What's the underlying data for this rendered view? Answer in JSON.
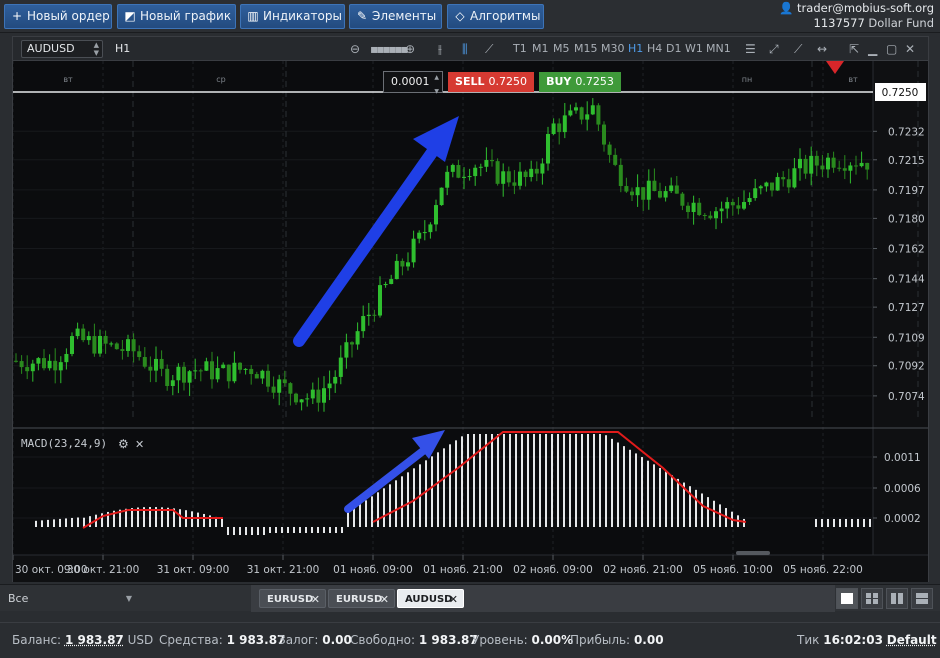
{
  "toolbar": {
    "new_order": "Новый ордер",
    "new_chart": "Новый график",
    "indicators": "Индикаторы",
    "elements": "Элементы",
    "algorithms": "Алгоритмы"
  },
  "account": {
    "email": "trader@mobius-soft.org",
    "id": "1137577",
    "fund": "Dollar Fund"
  },
  "chart": {
    "symbol": "AUDUSD",
    "timeframe": "H1",
    "timeframes": [
      "T1",
      "M1",
      "M5",
      "M15",
      "M30",
      "H1",
      "H4",
      "D1",
      "W1",
      "MN1"
    ],
    "active_timeframe": "H1",
    "step_value": "0.0001",
    "sell_label": "SELL",
    "sell_price": "0.7250",
    "buy_label": "BUY",
    "buy_price": "0.7253",
    "current_price_label": "0.7250",
    "day_labels": [
      "вт",
      "ср",
      "пн",
      "вт"
    ],
    "indicator_label": "MACD(23,24,9)",
    "colors": {
      "bull": "#2fbf2f",
      "bear": "#2a8a1e",
      "macd_signal": "#e11b1b",
      "arrow": "#1f3fe6",
      "sell": "#d63a32",
      "buy": "#3f9a3a"
    }
  },
  "chart_data": {
    "type": "candlestick",
    "x_tick_labels": [
      "30 окт. 09:00",
      "30 окт. 21:00",
      "31 окт. 09:00",
      "31 окт. 21:00",
      "01 нояб. 09:00",
      "01 нояб. 21:00",
      "02 нояб. 09:00",
      "02 нояб. 21:00",
      "05 нояб. 10:00",
      "05 нояб. 22:00"
    ],
    "y_tick_labels": [
      "0.7232",
      "0.7215",
      "0.7197",
      "0.7180",
      "0.7162",
      "0.7144",
      "0.7127",
      "0.7109",
      "0.7092",
      "0.7074"
    ],
    "ylim": [
      0.7059,
      0.7271
    ],
    "current_price": 0.725,
    "macd": {
      "name": "MACD(23,24,9)",
      "y_tick_labels": [
        "0.0011",
        "0.0006",
        "0.0002"
      ],
      "histogram_shape": "rises from near zero at 31 окт. 21:00 to a plateau around 01 нояб. 21:00 – 02 нояб. 09:00, then declines back to zero by 05 нояб. 10:00",
      "signal_color": "red"
    }
  },
  "tabs": {
    "filter_label": "Все",
    "items": [
      {
        "label": "EURUSD",
        "active": false
      },
      {
        "label": "EURUSD",
        "active": false
      },
      {
        "label": "AUDUSD",
        "active": true
      }
    ]
  },
  "status": {
    "balance_label": "Баланс:",
    "balance_value": "1 983.87",
    "balance_currency": "USD",
    "equity_label": "Средства:",
    "equity_value": "1 983.87",
    "margin_label": "Залог:",
    "margin_value": "0.00",
    "free_label": "Свободно:",
    "free_value": "1 983.87",
    "level_label": "Уровень:",
    "level_value": "0.00%",
    "profit_label": "Прибыль:",
    "profit_value": "0.00",
    "tick_label": "Тик",
    "tick_time": "16:02:03",
    "tick_mode": "Default"
  }
}
